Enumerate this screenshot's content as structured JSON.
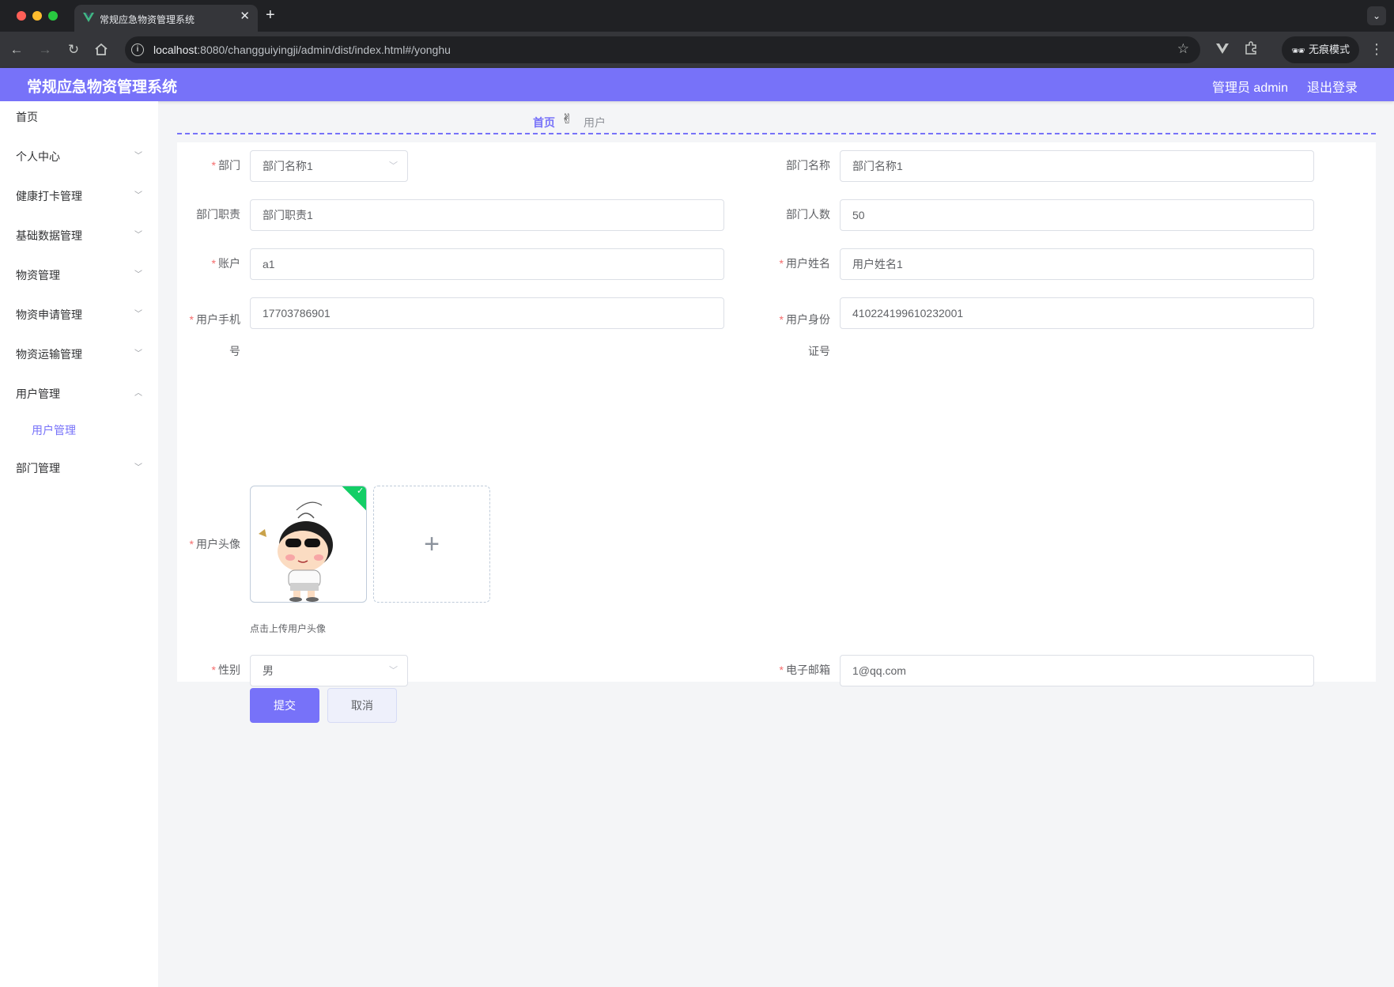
{
  "browser": {
    "tab_title": "常规应急物资管理系统",
    "url_host": "localhost",
    "url_path": ":8080/changguiyingji/admin/dist/index.html#/yonghu",
    "incognito_label": "无痕模式",
    "tab_icon_color": "#41b883"
  },
  "header": {
    "app_title": "常规应急物资管理系统",
    "admin_label": "管理员 admin",
    "logout_label": "退出登录",
    "accent_color": "#7772f9"
  },
  "sidebar": {
    "items": [
      {
        "label": "首页"
      },
      {
        "label": "个人中心"
      },
      {
        "label": "健康打卡管理"
      },
      {
        "label": "基础数据管理"
      },
      {
        "label": "物资管理"
      },
      {
        "label": "物资申请管理"
      },
      {
        "label": "物资运输管理"
      },
      {
        "label": "用户管理"
      },
      {
        "label": "部门管理"
      }
    ],
    "submenu_active": "用户管理"
  },
  "breadcrumb": {
    "home": "首页",
    "separator": "✌",
    "current": "用户"
  },
  "form": {
    "department": {
      "label": "部门",
      "value": "部门名称1"
    },
    "department_name": {
      "label": "部门名称",
      "value": "部门名称1"
    },
    "department_duty": {
      "label": "部门职责",
      "value": "部门职责1"
    },
    "department_count": {
      "label": "部门人数",
      "value": "50"
    },
    "account": {
      "label": "账户",
      "value": "a1"
    },
    "user_name": {
      "label": "用户姓名",
      "value": "用户姓名1"
    },
    "user_phone": {
      "label_line1": "用户手机",
      "label_line2": "号",
      "value": "17703786901"
    },
    "user_id_card": {
      "label_line1": "用户身份",
      "label_line2": "证号",
      "value": "410224199610232001"
    },
    "avatar": {
      "label": "用户头像",
      "tip": "点击上传用户头像"
    },
    "gender": {
      "label": "性别",
      "value": "男"
    },
    "email": {
      "label": "电子邮箱",
      "value": "1@qq.com"
    },
    "submit_label": "提交",
    "cancel_label": "取消",
    "required_mark": "*"
  }
}
